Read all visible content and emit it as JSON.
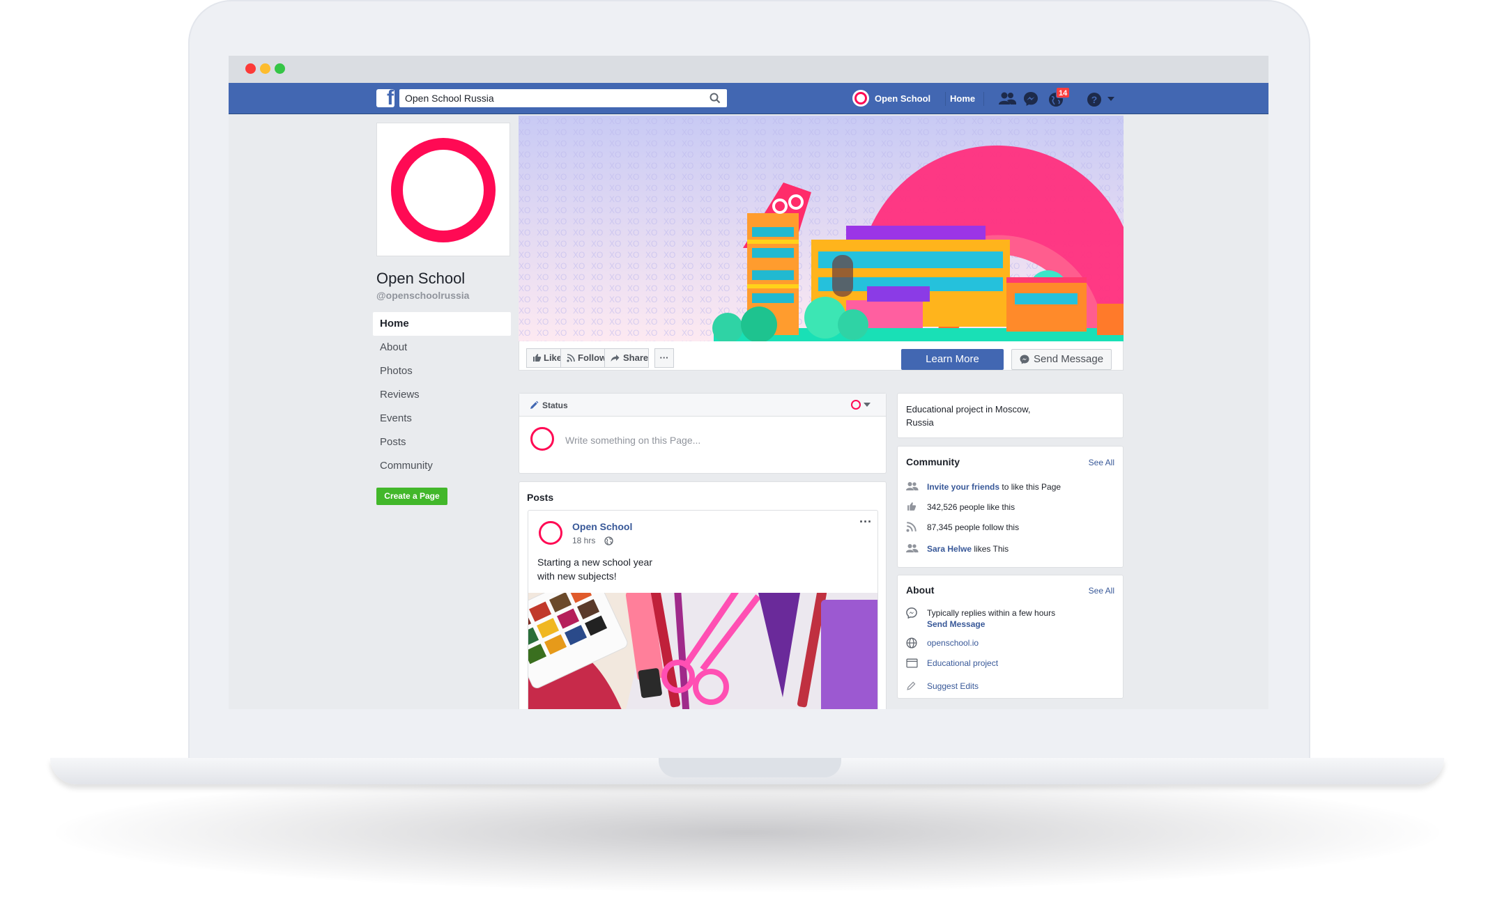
{
  "search": {
    "value": "Open School Russia"
  },
  "topnav": {
    "profile_label": "Open School",
    "home_label": "Home",
    "notification_count": "14"
  },
  "page": {
    "name": "Open School",
    "handle": "@openschoolrussia"
  },
  "leftnav": {
    "items": [
      "Home",
      "About",
      "Photos",
      "Reviews",
      "Events",
      "Posts",
      "Community"
    ],
    "create_page": "Create a Page"
  },
  "actions": {
    "like": "Like",
    "follow": "Follow",
    "share": "Share",
    "more": "···",
    "learn_more": "Learn More",
    "send_message": "Send Message"
  },
  "composer": {
    "status_tab": "Status",
    "placeholder": "Write something on this Page..."
  },
  "posts": {
    "heading": "Posts",
    "items": [
      {
        "author": "Open School",
        "time": "18 hrs",
        "text_line1": "Starting a new school year",
        "text_line2": "with new subjects!",
        "menu": "···"
      }
    ]
  },
  "sidebar": {
    "description_line1": "Educational project in Moscow,",
    "description_line2": "Russia",
    "community": {
      "title": "Community",
      "see_all": "See All",
      "invite_link": "Invite your friends",
      "invite_rest": " to like this Page",
      "likes": "342,526 people like this",
      "follows": "87,345 people follow this",
      "friend_name": "Sara Helwe",
      "friend_rest": " likes This"
    },
    "about": {
      "title": "About",
      "see_all": "See All",
      "replies": "Typically replies within a few hours",
      "send_message": "Send Message",
      "website": "openschool.io",
      "category": "Educational project",
      "suggest": "Suggest Edits"
    }
  },
  "colors": {
    "facebook_blue": "#4267b2",
    "brand_pink": "#ff0a54",
    "green": "#42b72a",
    "notification_red": "#fa3e3e"
  }
}
